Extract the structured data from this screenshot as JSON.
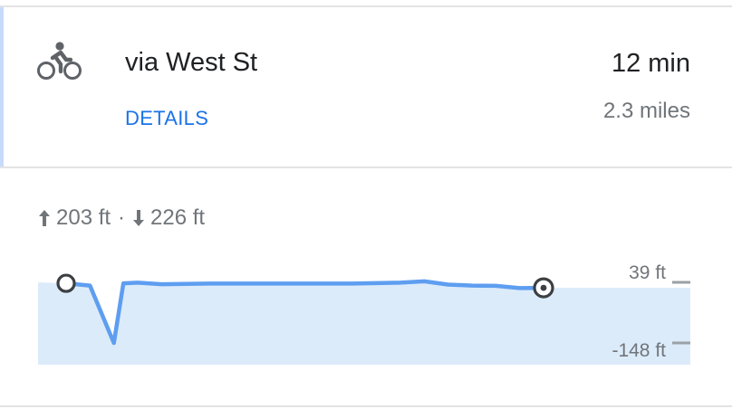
{
  "route": {
    "mode_icon": "bicycle-icon",
    "title": "via West St",
    "details_label": "DETAILS",
    "duration": "12 min",
    "distance": "2.3 miles"
  },
  "elevation": {
    "up_icon": "arrow-up-icon",
    "ascent": "203 ft",
    "separator": "·",
    "down_icon": "arrow-down-icon",
    "descent": "226 ft",
    "max_label": "39 ft",
    "min_label": "-148 ft"
  },
  "colors": {
    "link": "#1a73e8",
    "line": "#5e9ef0",
    "fill": "#dcebfa",
    "accent": "#c6dafc"
  },
  "chart_data": {
    "type": "area",
    "x": [
      0,
      0.05,
      0.1,
      0.12,
      0.15,
      0.2,
      0.3,
      0.4,
      0.5,
      0.6,
      0.7,
      0.75,
      0.8,
      0.85,
      0.9,
      0.95,
      1.0
    ],
    "y": [
      36,
      29,
      -148,
      36,
      38,
      33,
      35,
      35,
      35,
      35,
      38,
      42,
      32,
      29,
      28,
      21,
      22
    ],
    "ylim": [
      -148,
      39
    ],
    "y_tick_labels": [
      "39 ft",
      "-148 ft"
    ]
  }
}
